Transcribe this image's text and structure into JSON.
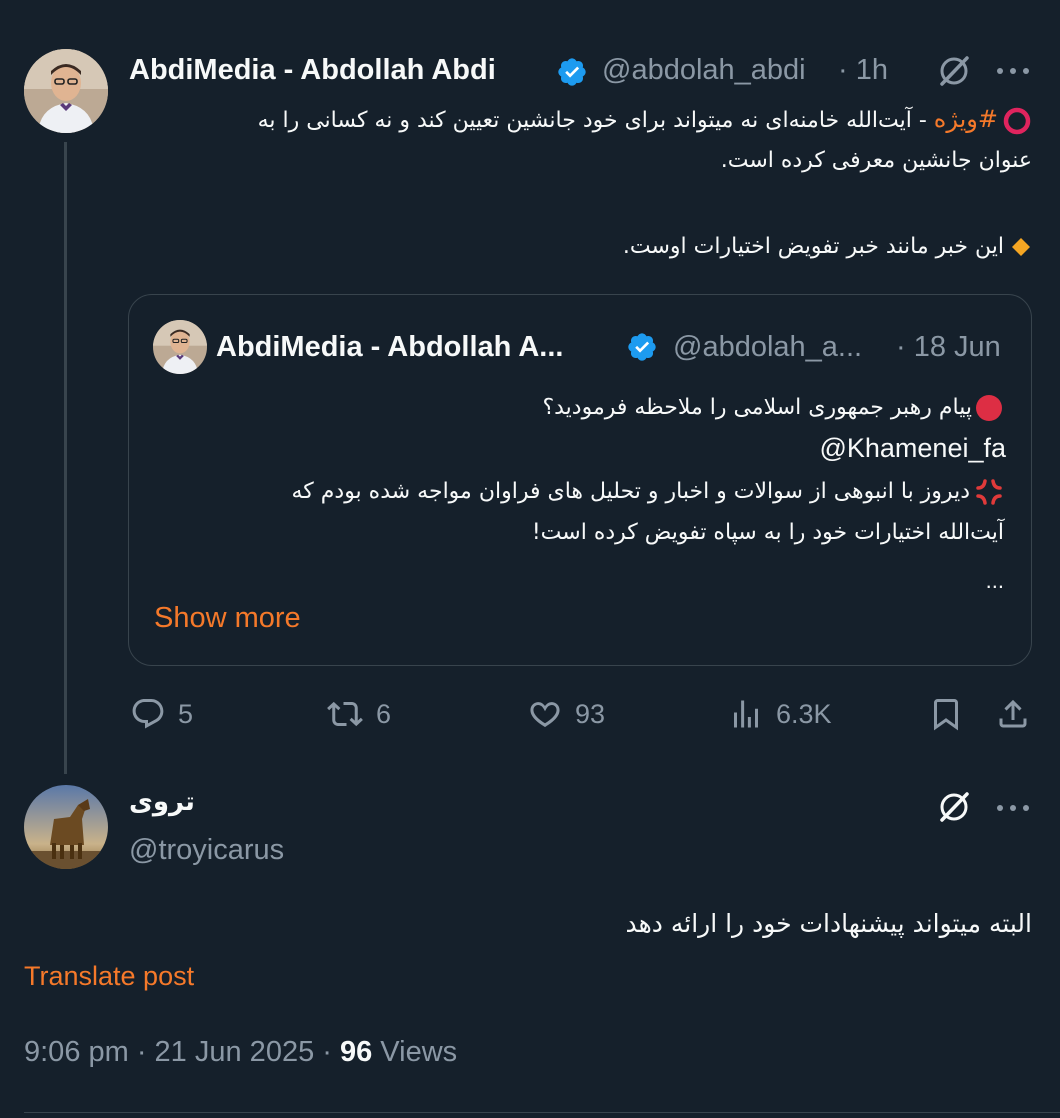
{
  "colors": {
    "background": "#15202b",
    "text": "#f7f9f9",
    "muted": "#8b98a5",
    "accent_orange": "#f5792a",
    "verified_blue": "#1d9bf0",
    "card_border": "#38444d"
  },
  "main_tweet": {
    "display_name": "AbdiMedia - Abdollah Abdi",
    "handle": "@abdolah_abdi",
    "time": "· 1h",
    "hashtag": "#ویژه",
    "text_line1_rest": " - آیت‌الله خامنه‌ای نه میتواند برای خود جانشین تعیین کند و نه کسانی را به",
    "text_line2": "عنوان جانشین معرفی کرده است.",
    "text_line3": "این خبر مانند خبر تفویض اختیارات اوست.",
    "icons": [
      "red-circle-icon",
      "orange-diamond-icon",
      "grok-icon",
      "more-icon",
      "verified-icon"
    ]
  },
  "quoted_tweet": {
    "display_name": "AbdiMedia - Abdollah A...",
    "handle": "@abdolah_a...",
    "date": "· 18 Jun",
    "line1": "پیام رهبر جمهوری اسلامی را ملاحظه فرمودید؟",
    "mention": "@Khamenei_fa",
    "line3": "دیروز با انبوهی از سوالات و اخبار و تحلیل های فراوان مواجه شده بودم که",
    "line4": "آیت‌الله اختیارات خود را به سپاه تفویض کرده است!",
    "ellipsis": "...",
    "show_more": "Show more"
  },
  "actions": {
    "replies": "5",
    "reposts": "6",
    "likes": "93",
    "views": "6.3K"
  },
  "reply_tweet": {
    "display_name": "تروی",
    "handle": "@troyicarus",
    "text": "البته میتواند پیشنهادات خود را ارائه دهد",
    "translate": "Translate post",
    "timestamp": "9:06 pm · 21 Jun 2025 · ",
    "views_count": "96",
    "views_label": " Views"
  }
}
